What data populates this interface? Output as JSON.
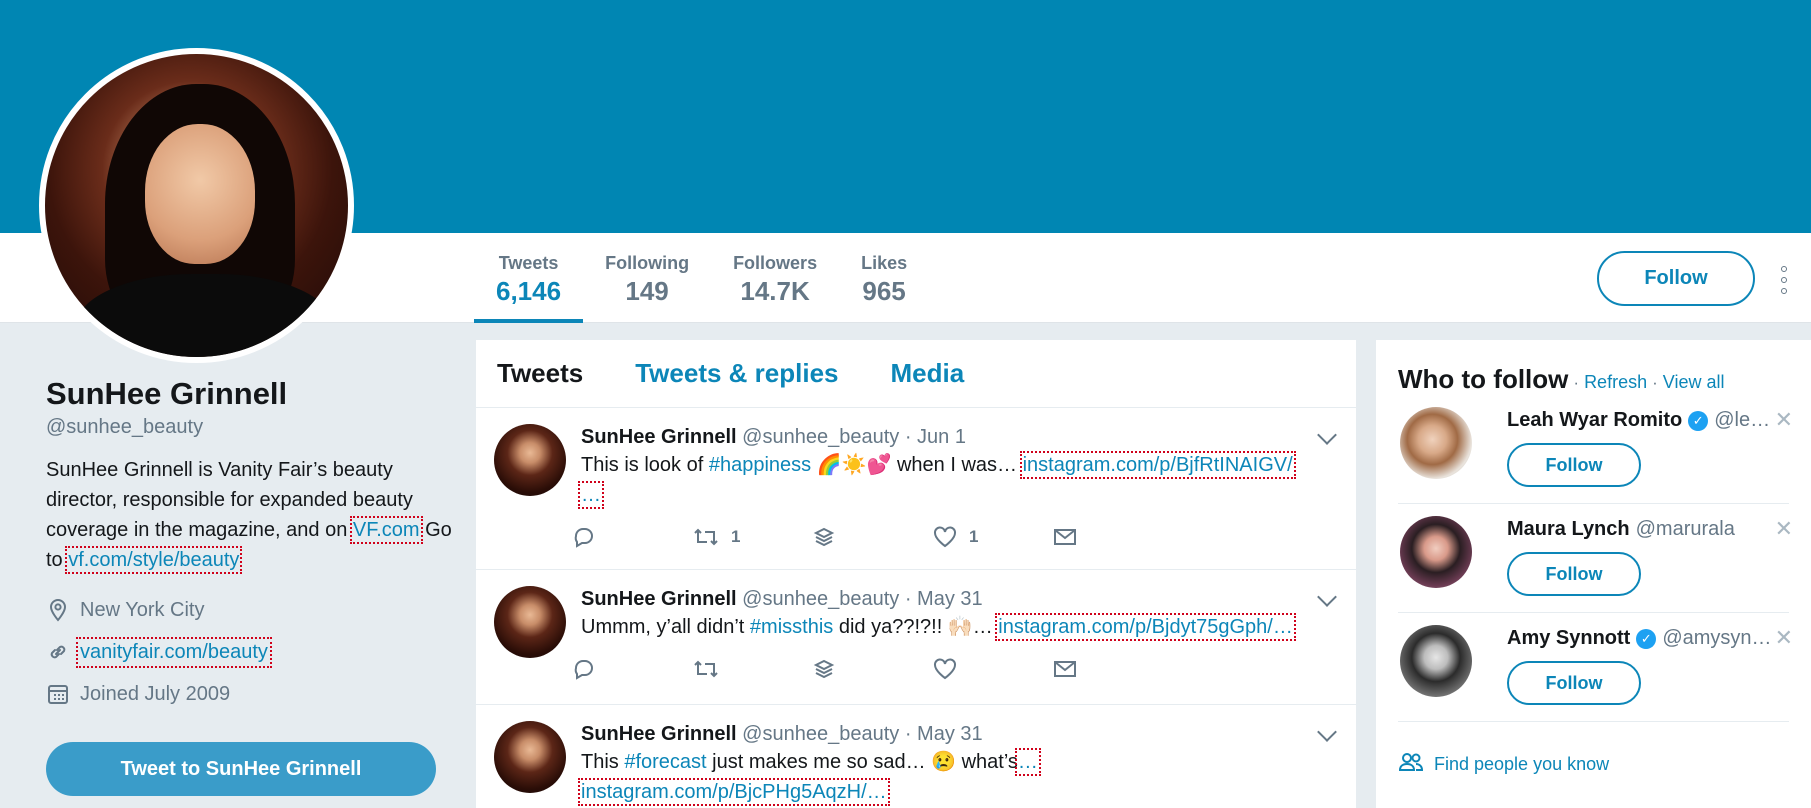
{
  "profile": {
    "name": "SunHee Grinnell",
    "handle": "@sunhee_beauty",
    "bio_text_1": "SunHee Grinnell is Vanity Fair’s beauty director, responsible for expanded beauty coverage in the magazine, and on ",
    "bio_link_1": "VF.com",
    "bio_text_2": " Go to ",
    "bio_link_2": "vf.com/style/beauty",
    "location": "New York City",
    "website": "vanityfair.com/beauty",
    "joined": "Joined July 2009",
    "tweet_to_label": "Tweet to SunHee Grinnell",
    "icons": {
      "location": "location-pin-icon",
      "link": "link-icon",
      "calendar": "calendar-icon"
    }
  },
  "nav": {
    "stats": [
      {
        "label": "Tweets",
        "value": "6,146"
      },
      {
        "label": "Following",
        "value": "149"
      },
      {
        "label": "Followers",
        "value": "14.7K"
      },
      {
        "label": "Likes",
        "value": "965"
      }
    ],
    "follow_label": "Follow"
  },
  "timeline": {
    "tabs": [
      "Tweets",
      "Tweets & replies",
      "Media"
    ],
    "tweets": [
      {
        "name": "SunHee Grinnell",
        "handle": "@sunhee_beauty",
        "date": "· Jun 1",
        "pre": "This is look of ",
        "tag": "#happiness",
        "emoji": " 🌈☀️💕 ",
        "post": "when I was… ",
        "link": "instagram.com/p/BjfRtINAIGV/",
        "link2": "…",
        "retweets": "1",
        "likes": "1"
      },
      {
        "name": "SunHee Grinnell",
        "handle": "@sunhee_beauty",
        "date": "· May 31",
        "pre": "Ummm, y’all didn’t ",
        "tag": "#missthis",
        "emoji": " did ya??!?!! 🙌🏻",
        "post": "… ",
        "link": "instagram.com/p/Bjdyt75gGph/…",
        "link2": "",
        "retweets": "",
        "likes": ""
      },
      {
        "name": "SunHee Grinnell",
        "handle": "@sunhee_beauty",
        "date": "· May 31",
        "pre": "This ",
        "tag": "#forecast",
        "emoji": " just makes me so sad… 😢 what’s",
        "post": "…",
        "link": "",
        "link2": "instagram.com/p/BjcPHg5AqzH/…",
        "retweets": "",
        "likes": ""
      }
    ]
  },
  "who_to_follow": {
    "title": "Who to follow",
    "refresh": "Refresh",
    "view_all": "View all",
    "suggestions": [
      {
        "name": "Leah Wyar Romito",
        "handle": "@le…",
        "verified": true,
        "follow": "Follow"
      },
      {
        "name": "Maura Lynch",
        "handle": "@marurala",
        "verified": false,
        "follow": "Follow"
      },
      {
        "name": "Amy Synnott",
        "handle": "@amysyn…",
        "verified": true,
        "follow": "Follow"
      }
    ],
    "find_people": "Find people you know"
  },
  "colors": {
    "banner": "#0086b3",
    "accent": "#0c86b8",
    "tweet_button": "#3a9cc9"
  }
}
